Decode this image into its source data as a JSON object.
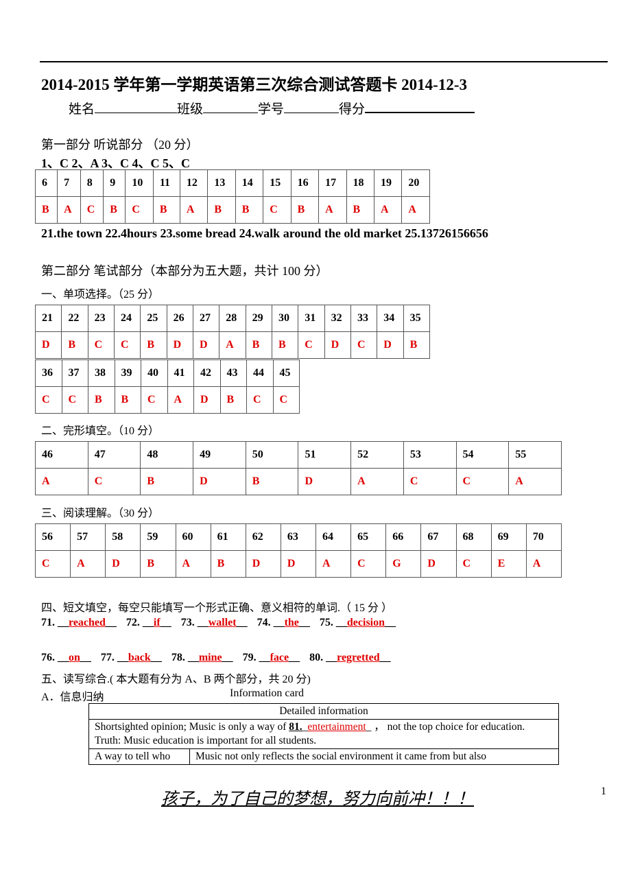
{
  "title": "2014-2015 学年第一学期英语第三次综合测试答题卡 2014-12-3",
  "fields": {
    "name": "姓名",
    "class": "班级",
    "number": "学号",
    "score": "得分"
  },
  "part1": {
    "heading": "第一部分  听说部分  （20 分）",
    "line1": "1、C 2、A 3、C 4、C 5、C",
    "table": {
      "numbers": [
        "6",
        "7",
        "8",
        "9",
        "10",
        "11",
        "12",
        "13",
        "14",
        "15",
        "16",
        "17",
        "18",
        "19",
        "20"
      ],
      "answers": [
        "B",
        "A",
        "C",
        "B",
        "C",
        "B",
        "A",
        "B",
        "B",
        "C",
        "B",
        "A",
        "B",
        "A",
        "A"
      ]
    },
    "line2": "21.the town 22.4hours 23.some bread 24.walk around the old market 25.13726156656"
  },
  "part2": {
    "heading": "第二部分    笔试部分（本部分为五大题，共计 100 分）",
    "s1": {
      "heading": "一、单项选择。（25 分）",
      "row1": {
        "numbers": [
          "21",
          "22",
          "23",
          "24",
          "25",
          "26",
          "27",
          "28",
          "29",
          "30",
          "31",
          "32",
          "33",
          "34",
          "35"
        ],
        "answers": [
          "D",
          "B",
          "C",
          "C",
          "B",
          "D",
          "D",
          "A",
          "B",
          "B",
          "C",
          "D",
          "C",
          "D",
          "B"
        ]
      },
      "row2": {
        "numbers": [
          "36",
          "37",
          "38",
          "39",
          "40",
          "41",
          "42",
          "43",
          "44",
          "45"
        ],
        "answers": [
          "C",
          "C",
          "B",
          "B",
          "C",
          "A",
          "D",
          "B",
          "C",
          "C"
        ]
      }
    },
    "s2": {
      "heading": "二、完形填空。（10 分）",
      "numbers": [
        "46",
        "47",
        "48",
        "49",
        "50",
        "51",
        "52",
        "53",
        "54",
        "55"
      ],
      "answers": [
        "A",
        "C",
        "B",
        "D",
        "B",
        "D",
        "A",
        "C",
        "C",
        "A"
      ]
    },
    "s3": {
      "heading": "三、阅读理解。（30 分）",
      "numbers": [
        "56",
        "57",
        "58",
        "59",
        "60",
        "61",
        "62",
        "63",
        "64",
        "65",
        "66",
        "67",
        "68",
        "69",
        "70"
      ],
      "answers": [
        "C",
        "A",
        "D",
        "B",
        "A",
        "B",
        "D",
        "D",
        "A",
        "C",
        "G",
        "D",
        "C",
        "E",
        "A"
      ]
    },
    "s4": {
      "heading": "四、短文填空，每空只能填写一个形式正确、意义相符的单词.（  15 分  ）",
      "items": [
        {
          "num": "71.",
          "answer": "reached"
        },
        {
          "num": "72.",
          "answer": "if"
        },
        {
          "num": "73.",
          "answer": "wallet"
        },
        {
          "num": "74.",
          "answer": "the"
        },
        {
          "num": "75.",
          "answer": "decision"
        },
        {
          "num": "76.",
          "answer": "on"
        },
        {
          "num": "77.",
          "answer": "back"
        },
        {
          "num": "78.",
          "answer": "mine"
        },
        {
          "num": "79.",
          "answer": "face"
        },
        {
          "num": "80.",
          "answer": "regretted"
        }
      ]
    },
    "s5": {
      "heading": "五、读写综合.(  本大题有分为 A、B 两个部分，共 20 分)",
      "sub_a": "A．信息归纳",
      "card_title": "Information card",
      "card_header": "Detailed information",
      "row1_text_a": "Shortsighted opinion; Music is only a way of ",
      "row1_num": "81.",
      "row1_answer": "entertainment",
      "row1_text_b": "，    not the top choice for education.",
      "row1_text_c": "Truth: Music education is important for all students.",
      "row2_left": "A way to tell who",
      "row2_right": "Music not only reflects the social environment it came from but also"
    }
  },
  "footer": {
    "motto": "孩子，为了自己的梦想，努力向前冲！！！",
    "page": "1"
  }
}
